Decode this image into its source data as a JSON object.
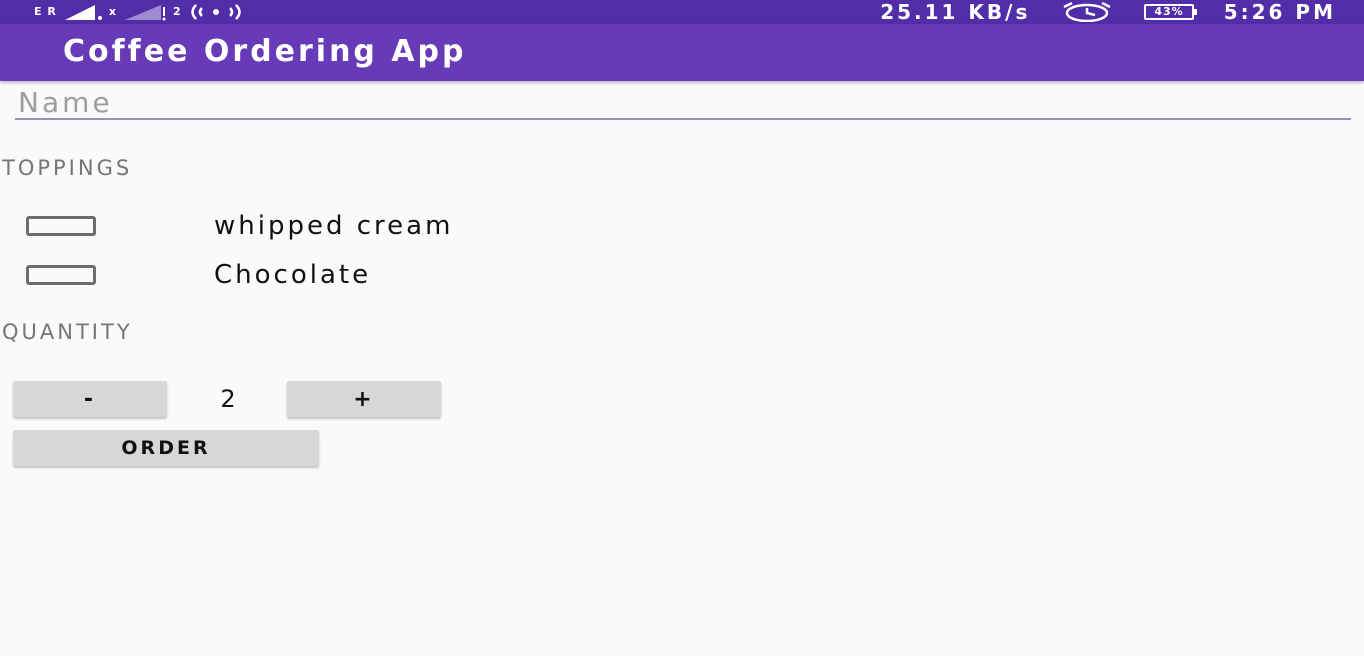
{
  "status_bar": {
    "signal_label": "E R",
    "signal_sub_1": "x",
    "signal_sub_2": "2",
    "network_speed": "25.11 KB/s",
    "alarm_icon": "alarm-clock-icon",
    "battery": "43%",
    "time": "5:26 PM"
  },
  "app_bar": {
    "title": "Coffee Ordering App",
    "color": "#673ab7",
    "status_color": "#512da8"
  },
  "name_field": {
    "placeholder": "Name",
    "value": ""
  },
  "toppings": {
    "header": "TOPPINGS",
    "items": [
      {
        "label": "whipped cream",
        "checked": false
      },
      {
        "label": "Chocolate",
        "checked": false
      }
    ]
  },
  "quantity": {
    "header": "QUANTITY",
    "decrement_label": "-",
    "value": "2",
    "increment_label": "+"
  },
  "order_button": {
    "label": "ORDER"
  }
}
